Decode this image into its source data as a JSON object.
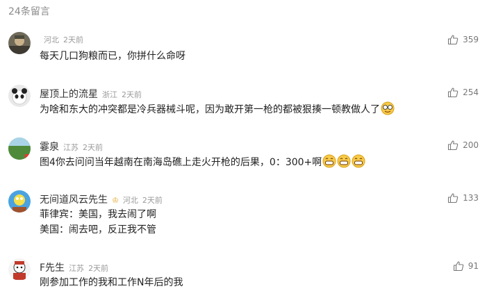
{
  "header": {
    "title": "24条留言"
  },
  "comments": [
    {
      "username": "",
      "location": "河北",
      "time": "2天前",
      "lines": [
        "每天几口狗粮而已，你拼什么命呀"
      ],
      "likes": "359"
    },
    {
      "username": "屋顶上的流星",
      "location": "浙江",
      "time": "2天前",
      "lines": [
        "为啥和东大的冲突都是冷兵器械斗呢，因为敢开第一枪的都被狠揍一顿教做人了"
      ],
      "likes": "254"
    },
    {
      "username": "霎泉",
      "location": "江苏",
      "time": "2天前",
      "lines": [
        "图4你去问问当年越南在南海岛礁上走火开枪的后果，0：300+啊"
      ],
      "likes": "200"
    },
    {
      "username": "无间道风云先生",
      "location": "河北",
      "time": "2天前",
      "lines": [
        "菲律宾：美国，我去闹了啊",
        "美国：闹去吧，反正我不管"
      ],
      "likes": "133"
    },
    {
      "username": "F先生",
      "location": "江苏",
      "time": "2天前",
      "lines": [
        "刚参加工作的我和工作N年后的我"
      ],
      "likes": "91"
    }
  ],
  "icons": {
    "like": "thumbs-up-icon",
    "badge": "vip-badge-icon",
    "emoji_smile": "grin-emoji",
    "emoji_glasses": "nerd-emoji"
  },
  "colors": {
    "header": "#8a8a8a",
    "meta": "#9a9a9a",
    "badge": "#e4a92b"
  }
}
